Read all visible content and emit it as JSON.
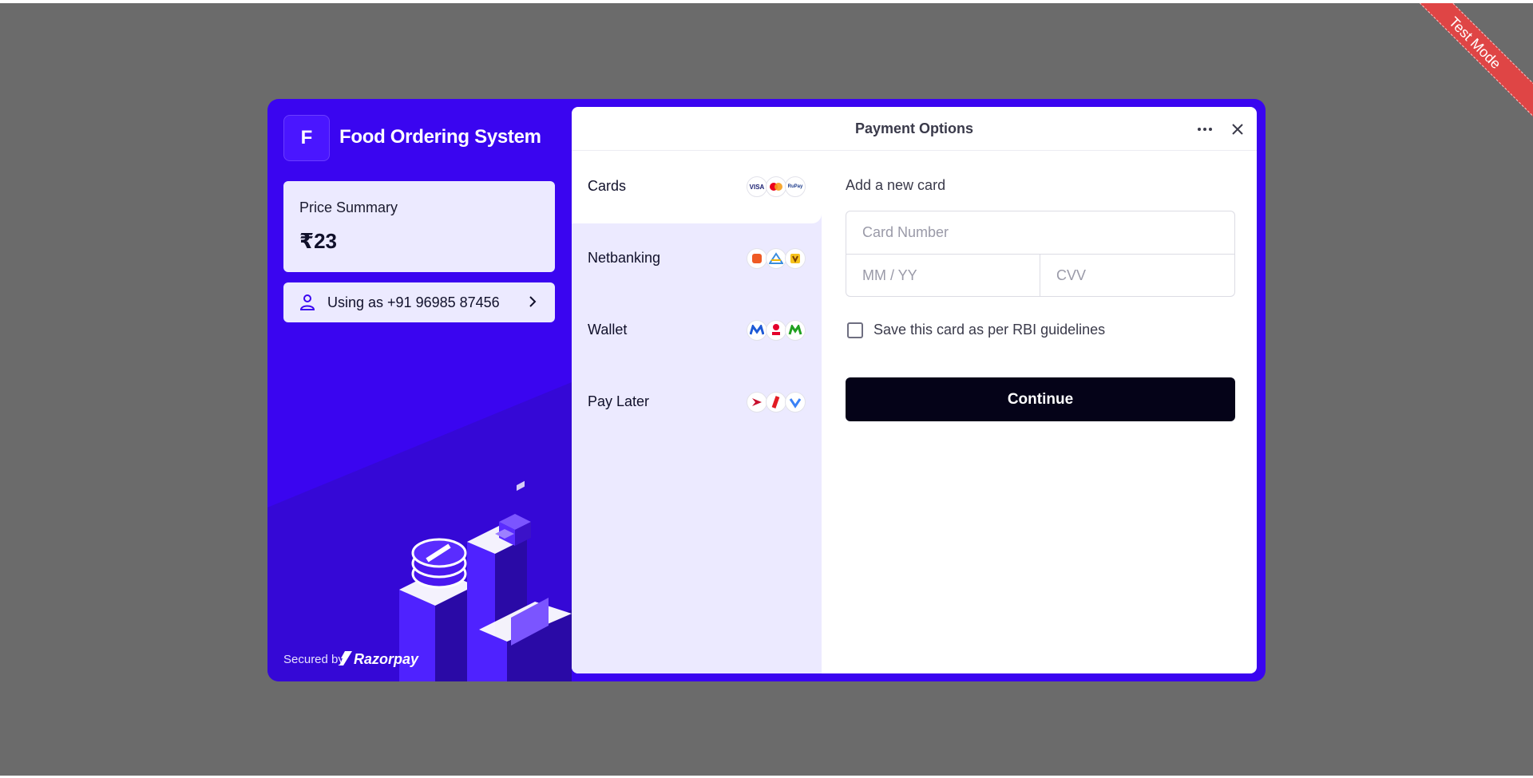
{
  "ribbon": {
    "label": "Test Mode"
  },
  "merchant": {
    "initial": "F",
    "name": "Food Ordering System"
  },
  "price_summary": {
    "label": "Price Summary",
    "amount": "₹23"
  },
  "user": {
    "label": "Using as +91 96985 87456"
  },
  "footer": {
    "secured_by": "Secured by",
    "brand": "Razorpay"
  },
  "header": {
    "title": "Payment Options"
  },
  "methods": [
    {
      "label": "Cards",
      "icons": [
        "visa-icon",
        "mastercard-icon",
        "rupay-icon"
      ]
    },
    {
      "label": "Netbanking",
      "icons": [
        "bank-icon",
        "bank-icon",
        "bank-icon"
      ]
    },
    {
      "label": "Wallet",
      "icons": [
        "wallet-icon",
        "wallet-icon",
        "wallet-icon"
      ]
    },
    {
      "label": "Pay Later",
      "icons": [
        "paylater-icon",
        "paylater-icon",
        "paylater-icon"
      ]
    }
  ],
  "card_icons": {
    "visa": "VISA",
    "rupay": "RuPay"
  },
  "form": {
    "title": "Add a new card",
    "card_number_placeholder": "Card Number",
    "expiry_placeholder": "MM / YY",
    "cvv_placeholder": "CVV",
    "save_label": "Save this card as per RBI guidelines",
    "continue_label": "Continue"
  },
  "colors": {
    "brand": "#3a05f0",
    "accent_light": "#eceaff",
    "button_dark": "#050318",
    "ribbon": "#df4545",
    "overlay": "#6b6b6b"
  }
}
